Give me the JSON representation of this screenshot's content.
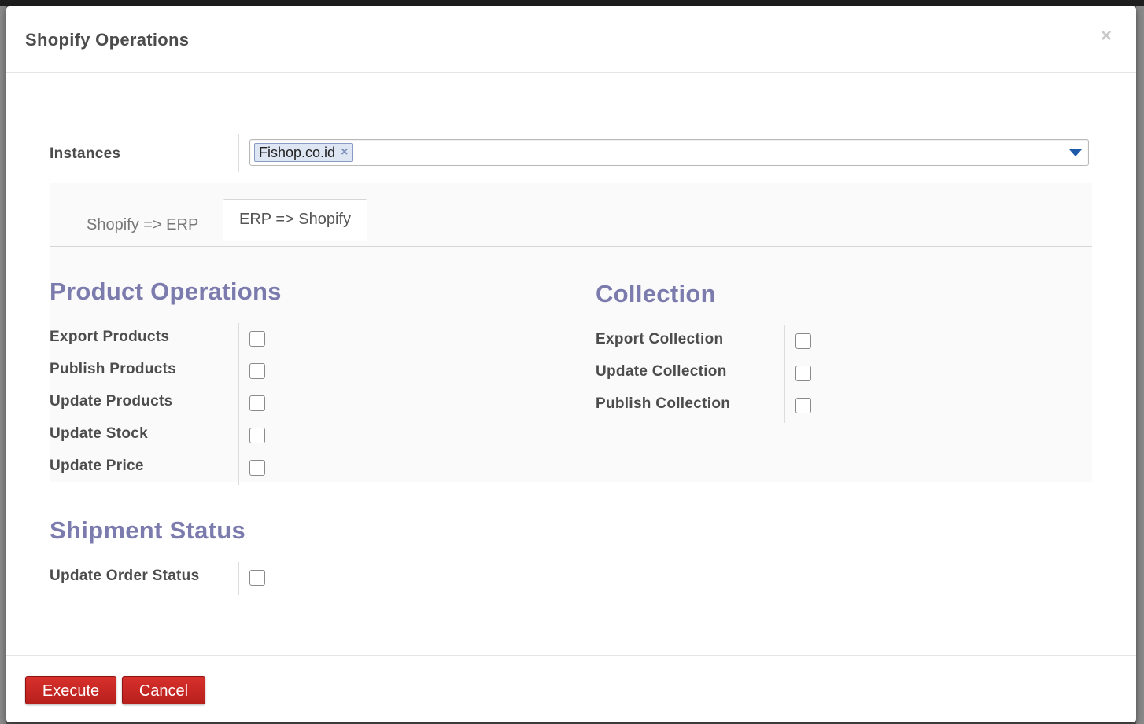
{
  "dialog": {
    "title": "Shopify Operations",
    "close_symbol": "×"
  },
  "instances": {
    "label": "Instances",
    "tags": [
      "Fishop.co.id"
    ],
    "tag_remove_symbol": "×"
  },
  "tabs": [
    {
      "label": "Shopify => ERP",
      "active": false
    },
    {
      "label": "ERP => Shopify",
      "active": true
    }
  ],
  "product_operations": {
    "title": "Product Operations",
    "items": [
      {
        "label": "Export Products",
        "checked": false
      },
      {
        "label": "Publish Products",
        "checked": false
      },
      {
        "label": "Update Products",
        "checked": false
      },
      {
        "label": "Update Stock",
        "checked": false
      },
      {
        "label": "Update Price",
        "checked": false
      }
    ]
  },
  "collection": {
    "title": "Collection",
    "items": [
      {
        "label": "Export Collection",
        "checked": false
      },
      {
        "label": "Update Collection",
        "checked": false
      },
      {
        "label": "Publish Collection",
        "checked": false
      }
    ]
  },
  "shipment_status": {
    "title": "Shipment Status",
    "items": [
      {
        "label": "Update Order Status",
        "checked": false
      }
    ]
  },
  "footer": {
    "execute_label": "Execute",
    "cancel_label": "Cancel"
  },
  "colors": {
    "section_title": "#7c7bad",
    "button_red": "#c9261f",
    "dropdown_arrow": "#1e5aa8"
  }
}
